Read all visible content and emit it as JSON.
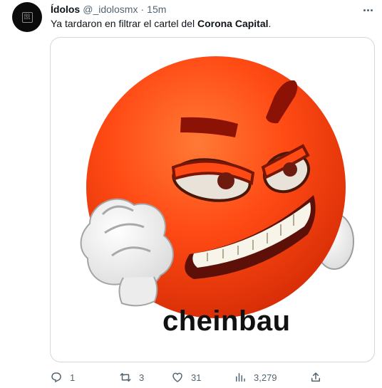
{
  "tweet": {
    "display_name": "Ídolos",
    "handle": "@_idolosmx",
    "separator": "·",
    "time": "15m",
    "text_prefix": "Ya tardaron en filtrar el cartel del ",
    "text_bold": "Corona Capital",
    "text_suffix": ".",
    "avatar_logo": "IDO\nLOS",
    "media_caption": "cheinbau"
  },
  "actions": {
    "reply_count": "1",
    "retweet_count": "3",
    "like_count": "31",
    "views_count": "3,279"
  },
  "icons": [
    "reply-icon",
    "retweet-icon",
    "like-icon",
    "views-icon",
    "share-icon",
    "more-icon"
  ]
}
